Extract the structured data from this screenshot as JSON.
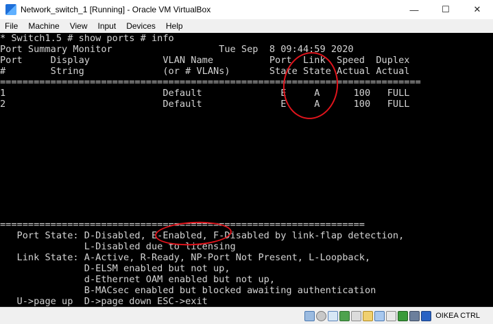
{
  "window": {
    "title": "Network_switch_1 [Running] - Oracle VM VirtualBox",
    "controls": {
      "minimize": "—",
      "maximize": "☐",
      "close": "✕"
    }
  },
  "menu": [
    "File",
    "Machine",
    "View",
    "Input",
    "Devices",
    "Help"
  ],
  "console": {
    "lines": [
      "* Switch1.5 # show ports # info",
      "Port Summary Monitor                   Tue Sep  8 09:44:59 2020",
      "Port     Display             VLAN Name          Port  Link  Speed  Duplex",
      "#        String              (or # VLANs)       State State Actual Actual",
      "===========================================================================",
      "1                            Default              E     A      100   FULL",
      "2                            Default              E     A      100   FULL",
      "=================================================================",
      "   Port State: D-Disabled, E-Enabled, F-Disabled by link-flap detection,",
      "               L-Disabled due to licensing",
      "   Link State: A-Active, R-Ready, NP-Port Not Present, L-Loopback,",
      "               D-ELSM enabled but not up,",
      "               d-Ethernet OAM enabled but not up,",
      "               B-MACsec enabled but blocked awaiting authentication",
      "   U->page up  D->page down ESC->exit"
    ]
  },
  "status_bar": {
    "icons": [
      "hdd-icon",
      "optical-disk-icon",
      "audio-icon",
      "network-icon",
      "usb-icon",
      "shared-folder-icon",
      "display-icon",
      "recording-icon",
      "mouse-integration-icon",
      "cpu-icon",
      "arrow-icon"
    ],
    "host_key": "OIKEA CTRL"
  }
}
